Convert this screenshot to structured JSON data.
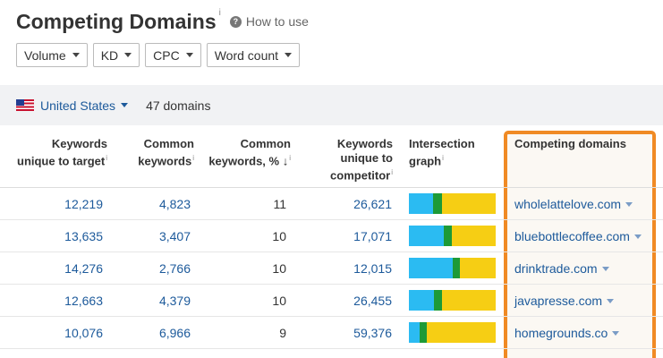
{
  "header": {
    "title": "Competing Domains",
    "title_info": "i",
    "help_icon": "question-circle-icon",
    "howto_label": "How to use"
  },
  "filters": [
    {
      "label": "Volume"
    },
    {
      "label": "KD"
    },
    {
      "label": "CPC"
    },
    {
      "label": "Word count"
    }
  ],
  "infobar": {
    "country": "United States",
    "flag_icon": "us-flag-icon",
    "domain_count": "47 domains"
  },
  "table": {
    "columns": {
      "kw_unique_target": {
        "line1": "Keywords",
        "line2": "unique to target",
        "info": "i"
      },
      "common_kw": {
        "line1": "Common",
        "line2": "keywords",
        "info": "i"
      },
      "common_kw_pct": {
        "line1": "Common",
        "line2": "keywords, %",
        "sort": "↓",
        "info": "i"
      },
      "kw_unique_comp": {
        "line1": "Keywords",
        "line2": "unique to",
        "line3": "competitor",
        "info": "i"
      },
      "intersection": {
        "line1": "Intersection",
        "line2": "graph",
        "info": "i"
      },
      "competing": {
        "line1": "Competing domains"
      }
    },
    "rows": [
      {
        "unique_target": "12,219",
        "common": "4,823",
        "pct": "11",
        "unique_comp": "26,621",
        "graph": [
          0.28,
          0.1,
          0.62
        ],
        "domain": "wholelattelove.com"
      },
      {
        "unique_target": "13,635",
        "common": "3,407",
        "pct": "10",
        "unique_comp": "17,071",
        "graph": [
          0.4,
          0.1,
          0.5
        ],
        "domain": "bluebottlecoffee.com"
      },
      {
        "unique_target": "14,276",
        "common": "2,766",
        "pct": "10",
        "unique_comp": "12,015",
        "graph": [
          0.5,
          0.09,
          0.41
        ],
        "domain": "drinktrade.com"
      },
      {
        "unique_target": "12,663",
        "common": "4,379",
        "pct": "10",
        "unique_comp": "26,455",
        "graph": [
          0.29,
          0.09,
          0.62
        ],
        "domain": "javapresse.com"
      },
      {
        "unique_target": "10,076",
        "common": "6,966",
        "pct": "9",
        "unique_comp": "59,376",
        "graph": [
          0.12,
          0.09,
          0.79
        ],
        "domain": "homegrounds.co"
      }
    ]
  },
  "colors": {
    "link": "#1d5a9b",
    "graph_unique_target": "#2bbbf2",
    "graph_common": "#1d9a37",
    "graph_unique_comp": "#f6ce14",
    "highlight": "#f08a24"
  }
}
